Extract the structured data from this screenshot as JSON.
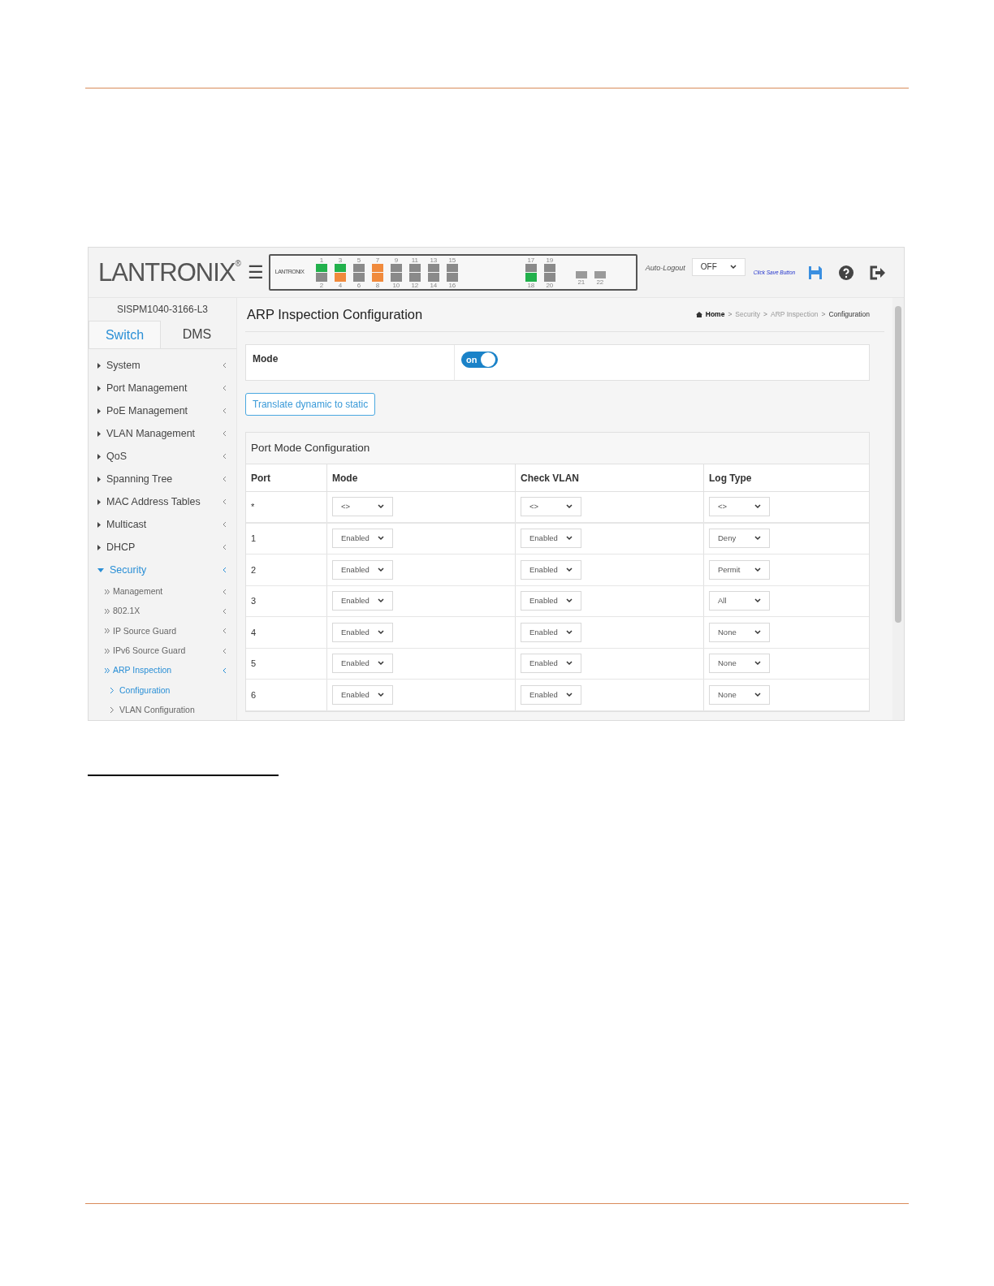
{
  "header": {
    "logo": "LANTRONIX",
    "logo_mark": "®",
    "menu_glyph": "☰",
    "panel": {
      "brand": "LANTRONIX",
      "ports": [
        {
          "top": {
            "label": "1",
            "color": "#22b14c"
          },
          "bottom": {
            "label": "2",
            "color": "#8a8a8a"
          }
        },
        {
          "top": {
            "label": "3",
            "color": "#22b14c"
          },
          "bottom": {
            "label": "4",
            "color": "#f08a3c"
          }
        },
        {
          "top": {
            "label": "5",
            "color": "#8a8a8a"
          },
          "bottom": {
            "label": "6",
            "color": "#8a8a8a"
          }
        },
        {
          "top": {
            "label": "7",
            "color": "#f08a3c"
          },
          "bottom": {
            "label": "8",
            "color": "#f08a3c"
          }
        },
        {
          "top": {
            "label": "9",
            "color": "#8a8a8a"
          },
          "bottom": {
            "label": "10",
            "color": "#8a8a8a"
          }
        },
        {
          "top": {
            "label": "11",
            "color": "#8a8a8a"
          },
          "bottom": {
            "label": "12",
            "color": "#8a8a8a"
          }
        },
        {
          "top": {
            "label": "13",
            "color": "#8a8a8a"
          },
          "bottom": {
            "label": "14",
            "color": "#8a8a8a"
          }
        },
        {
          "top": {
            "label": "15",
            "color": "#8a8a8a"
          },
          "bottom": {
            "label": "16",
            "color": "#8a8a8a"
          }
        }
      ],
      "sfp": [
        {
          "top": {
            "label": "17",
            "color": "#8a8a8a"
          },
          "bottom": {
            "label": "18",
            "color": "#22b14c"
          }
        },
        {
          "top": {
            "label": "19",
            "color": "#8a8a8a"
          },
          "bottom": {
            "label": "20",
            "color": "#8a8a8a"
          }
        }
      ],
      "uplinks": [
        {
          "label": "21"
        },
        {
          "label": "22"
        }
      ]
    },
    "auto_logout_label": "Auto-Logout",
    "auto_logout_value": "OFF",
    "save_hint": "Click Save Button"
  },
  "sidebar": {
    "model": "SISPM1040-3166-L3",
    "tabs": [
      {
        "label": "Switch",
        "selected": true
      },
      {
        "label": "DMS",
        "selected": false
      }
    ],
    "items": [
      {
        "label": "System",
        "expanded": false,
        "selected": false
      },
      {
        "label": "Port Management",
        "expanded": false,
        "selected": false
      },
      {
        "label": "PoE Management",
        "expanded": false,
        "selected": false
      },
      {
        "label": "VLAN Management",
        "expanded": false,
        "selected": false
      },
      {
        "label": "QoS",
        "expanded": false,
        "selected": false
      },
      {
        "label": "Spanning Tree",
        "expanded": false,
        "selected": false
      },
      {
        "label": "MAC Address Tables",
        "expanded": false,
        "selected": false
      },
      {
        "label": "Multicast",
        "expanded": false,
        "selected": false
      },
      {
        "label": "DHCP",
        "expanded": false,
        "selected": false
      },
      {
        "label": "Security",
        "expanded": true,
        "selected": true,
        "children": [
          {
            "label": "Management",
            "expanded": false,
            "selected": false
          },
          {
            "label": "802.1X",
            "expanded": false,
            "selected": false
          },
          {
            "label": "IP Source Guard",
            "expanded": false,
            "selected": false
          },
          {
            "label": "IPv6 Source Guard",
            "expanded": false,
            "selected": false
          },
          {
            "label": "ARP Inspection",
            "expanded": true,
            "selected": true,
            "children": [
              {
                "label": "Configuration",
                "selected": true
              },
              {
                "label": "VLAN Configuration",
                "selected": false
              }
            ]
          }
        ]
      }
    ]
  },
  "content": {
    "title": "ARP Inspection Configuration",
    "breadcrumb_separator": ">",
    "breadcrumb": [
      {
        "label": "Home",
        "current": false
      },
      {
        "label": "Security",
        "current": false
      },
      {
        "label": "ARP Inspection",
        "current": false
      },
      {
        "label": "Configuration",
        "current": true
      }
    ],
    "mode": {
      "label": "Mode",
      "toggle_text": "on",
      "on": true
    },
    "translate_button": "Translate dynamic to static",
    "port_mode": {
      "title": "Port Mode Configuration",
      "columns": [
        "Port",
        "Mode",
        "Check VLAN",
        "Log Type"
      ],
      "rows": [
        {
          "port": "*",
          "mode": "<>",
          "check_vlan": "<>",
          "log_type": "<>"
        },
        {
          "port": "1",
          "mode": "Enabled",
          "check_vlan": "Enabled",
          "log_type": "Deny"
        },
        {
          "port": "2",
          "mode": "Enabled",
          "check_vlan": "Enabled",
          "log_type": "Permit"
        },
        {
          "port": "3",
          "mode": "Enabled",
          "check_vlan": "Enabled",
          "log_type": "All"
        },
        {
          "port": "4",
          "mode": "Enabled",
          "check_vlan": "Enabled",
          "log_type": "None"
        },
        {
          "port": "5",
          "mode": "Enabled",
          "check_vlan": "Enabled",
          "log_type": "None"
        },
        {
          "port": "6",
          "mode": "Enabled",
          "check_vlan": "Enabled",
          "log_type": "None"
        }
      ]
    }
  }
}
